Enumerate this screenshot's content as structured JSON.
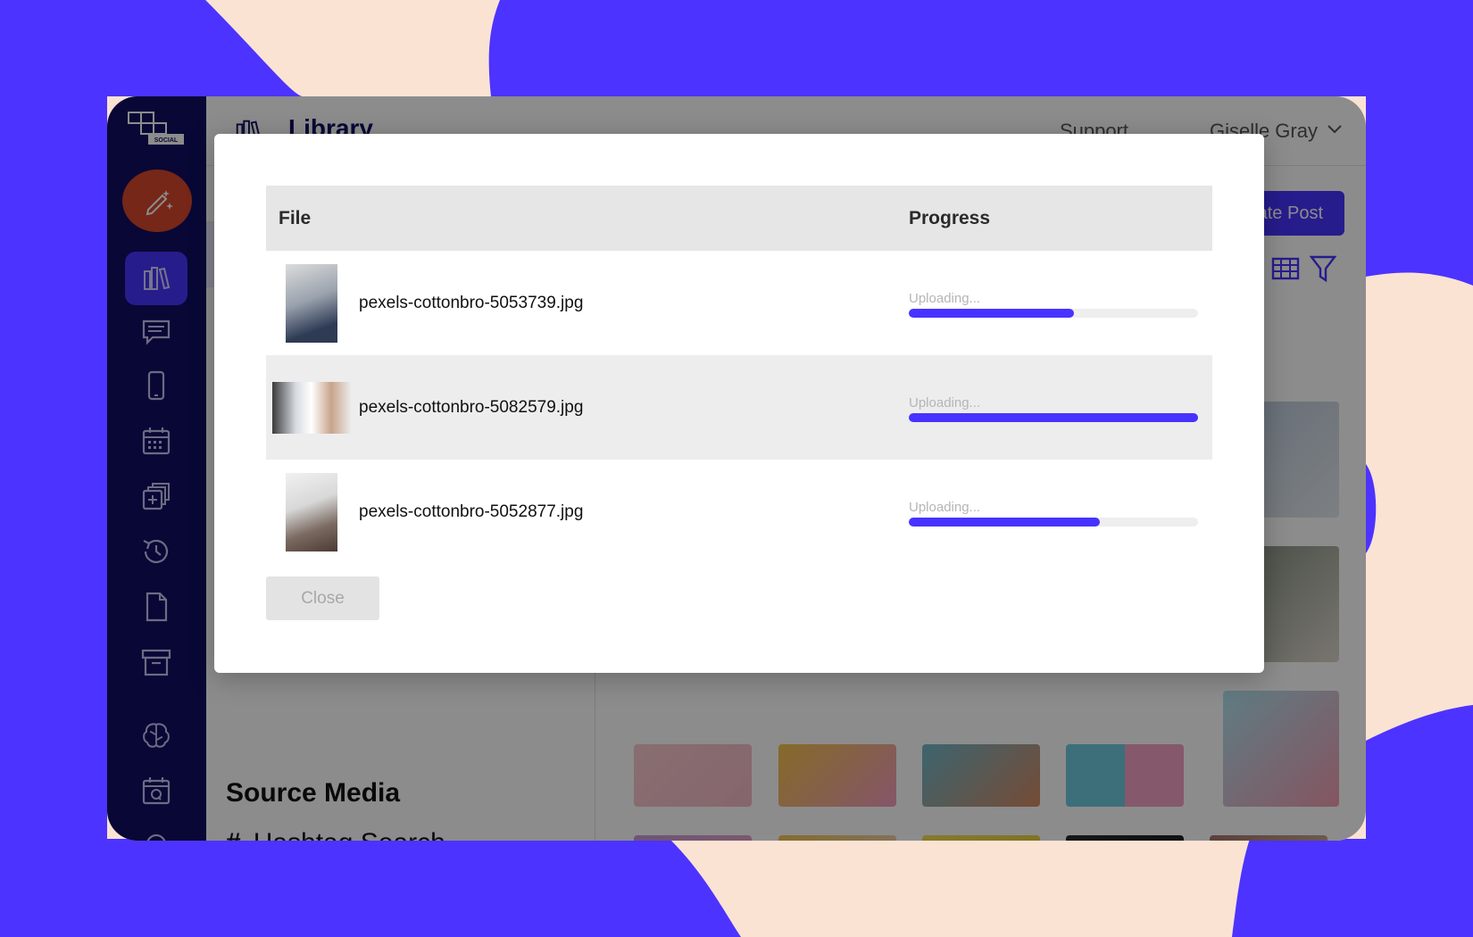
{
  "app": {
    "header": {
      "title": "Library",
      "support_label": "Support",
      "user_name": "Giselle Gray"
    },
    "content": {
      "create_post_label": "Create Post"
    },
    "left_panel": {
      "source_title": "Source Media",
      "hashtag_label": "Hashtag Search"
    },
    "sidebar": {
      "items": [
        {
          "icon": "library-icon",
          "active": true
        },
        {
          "icon": "chat-icon"
        },
        {
          "icon": "phone-icon"
        },
        {
          "icon": "calendar-icon"
        },
        {
          "icon": "add-stack-icon"
        },
        {
          "icon": "history-icon"
        },
        {
          "icon": "document-icon"
        },
        {
          "icon": "archive-icon"
        },
        {
          "icon": "brain-icon"
        },
        {
          "icon": "calendar-q-icon"
        }
      ]
    }
  },
  "modal": {
    "headers": {
      "file": "File",
      "progress": "Progress"
    },
    "files": [
      {
        "name": "pexels-cottonbro-5053739.jpg",
        "status": "Uploading...",
        "progress": 0.57
      },
      {
        "name": "pexels-cottonbro-5082579.jpg",
        "status": "Uploading...",
        "progress": 1.0
      },
      {
        "name": "pexels-cottonbro-5052877.jpg",
        "status": "Uploading...",
        "progress": 0.66
      }
    ],
    "close_label": "Close"
  },
  "colors": {
    "accent": "#4733ff",
    "sidebar": "#110e62",
    "create": "#d7472b",
    "background_blob": "#4d33ff",
    "background": "#fae3d3"
  }
}
